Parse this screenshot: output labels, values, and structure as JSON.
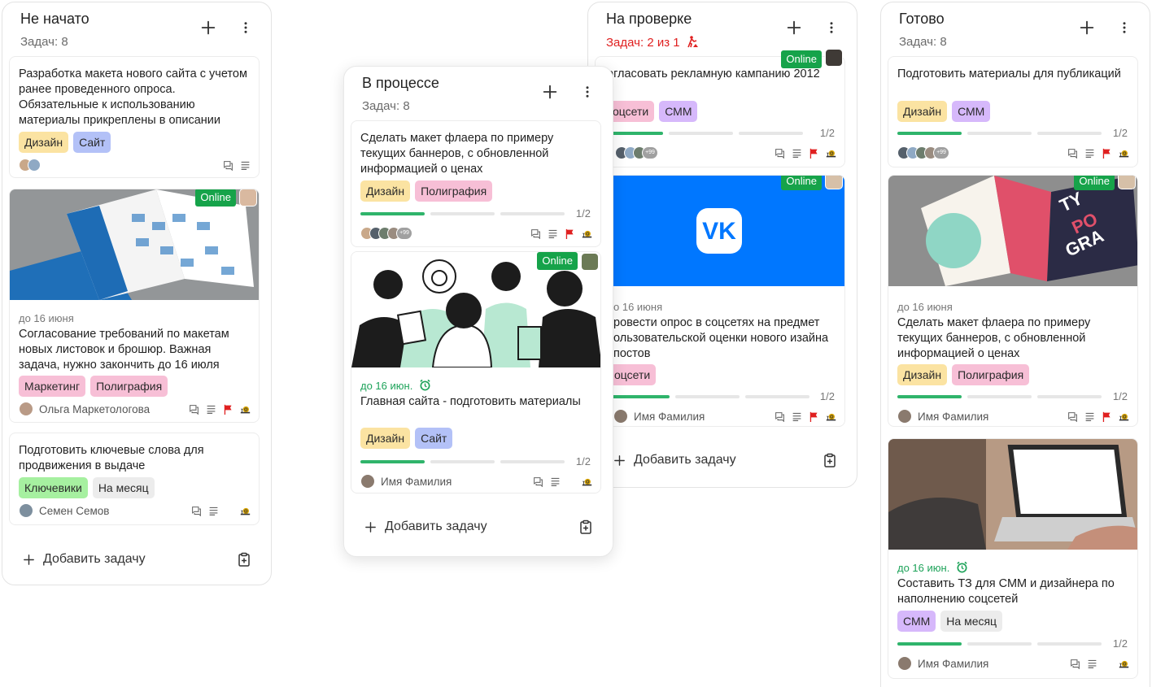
{
  "labels": {
    "online": "Online",
    "add_task": "Добавить задачу",
    "avatars_more": "+99"
  },
  "columns": {
    "c1": {
      "title": "Не начато",
      "count": "Задач: 8",
      "cards": [
        {
          "text": "Разработка макета нового сайта с учетом ранее проведенного опроса. Обязательные к использованию материалы прикреплены в описании",
          "tags": [
            "Дизайн",
            "Сайт"
          ]
        },
        {
          "due": "до 16 июня",
          "text": "Согласование требований по макетам новых листовок и брошюр. Важная задача, нужно закончить до 16 июля",
          "tags": [
            "Маркетинг",
            "Полиграфия"
          ],
          "person": "Ольга Маркетологова"
        },
        {
          "text": "Подготовить ключевые слова для продвижения в выдаче",
          "tags": [
            "Ключевики",
            "На месяц"
          ],
          "person": "Семен Семов"
        }
      ]
    },
    "c2": {
      "title": "В процессе",
      "count": "Задач: 8",
      "cards": [
        {
          "text": "Сделать макет флаера по примеру текущих баннеров, с обновленной информацией о ценах",
          "tags": [
            "Дизайн",
            "Полиграфия"
          ],
          "progress": "1/2"
        },
        {
          "due": "до 16 июн.",
          "text": "Главная сайта - подготовить материалы",
          "tags": [
            "Дизайн",
            "Сайт"
          ],
          "progress": "1/2",
          "person": "Имя Фамилия"
        }
      ]
    },
    "c3": {
      "title": "На проверке",
      "count": "Задач: 2 из 1",
      "cards": [
        {
          "text": "огласовать рекламную кампанию 2012",
          "tags": [
            "оцсети",
            "СММ"
          ],
          "progress": "1/2"
        },
        {
          "due": "о 16 июня",
          "text": "ровести опрос в соцсетях на предмет ользовательской оценки нового изайна постов",
          "tags": [
            "оцсети"
          ],
          "progress": "1/2",
          "person": "Имя Фамилия"
        }
      ]
    },
    "c4": {
      "title": "Готово",
      "count": "Задач: 8",
      "cards": [
        {
          "text": "Подготовить материалы для публикаций",
          "tags": [
            "Дизайн",
            "СММ"
          ],
          "progress": "1/2"
        },
        {
          "due": "до 16 июня",
          "text": "Сделать макет флаера по примеру текущих баннеров, с обновленной информацией о ценах",
          "tags": [
            "Дизайн",
            "Полиграфия"
          ],
          "progress": "1/2",
          "person": "Имя Фамилия"
        },
        {
          "due": "до 16 июн.",
          "text": "Составить ТЗ для СММ и дизайнера по наполнению соцсетей",
          "tags": [
            "СММ",
            "На месяц"
          ],
          "progress": "1/2",
          "person": "Имя Фамилия"
        }
      ]
    }
  },
  "colors": {
    "online_badge": "#16a34a",
    "progress_done": "#2fb46b",
    "alert_count": "#e02020",
    "vk_blue": "#0077ff"
  },
  "icons": [
    "plus-icon",
    "more-vertical-icon",
    "comment-icon",
    "description-icon",
    "flag-icon",
    "snail-icon",
    "alarm-icon",
    "clipboard-icon",
    "vk-logo",
    "hazard-icon"
  ]
}
